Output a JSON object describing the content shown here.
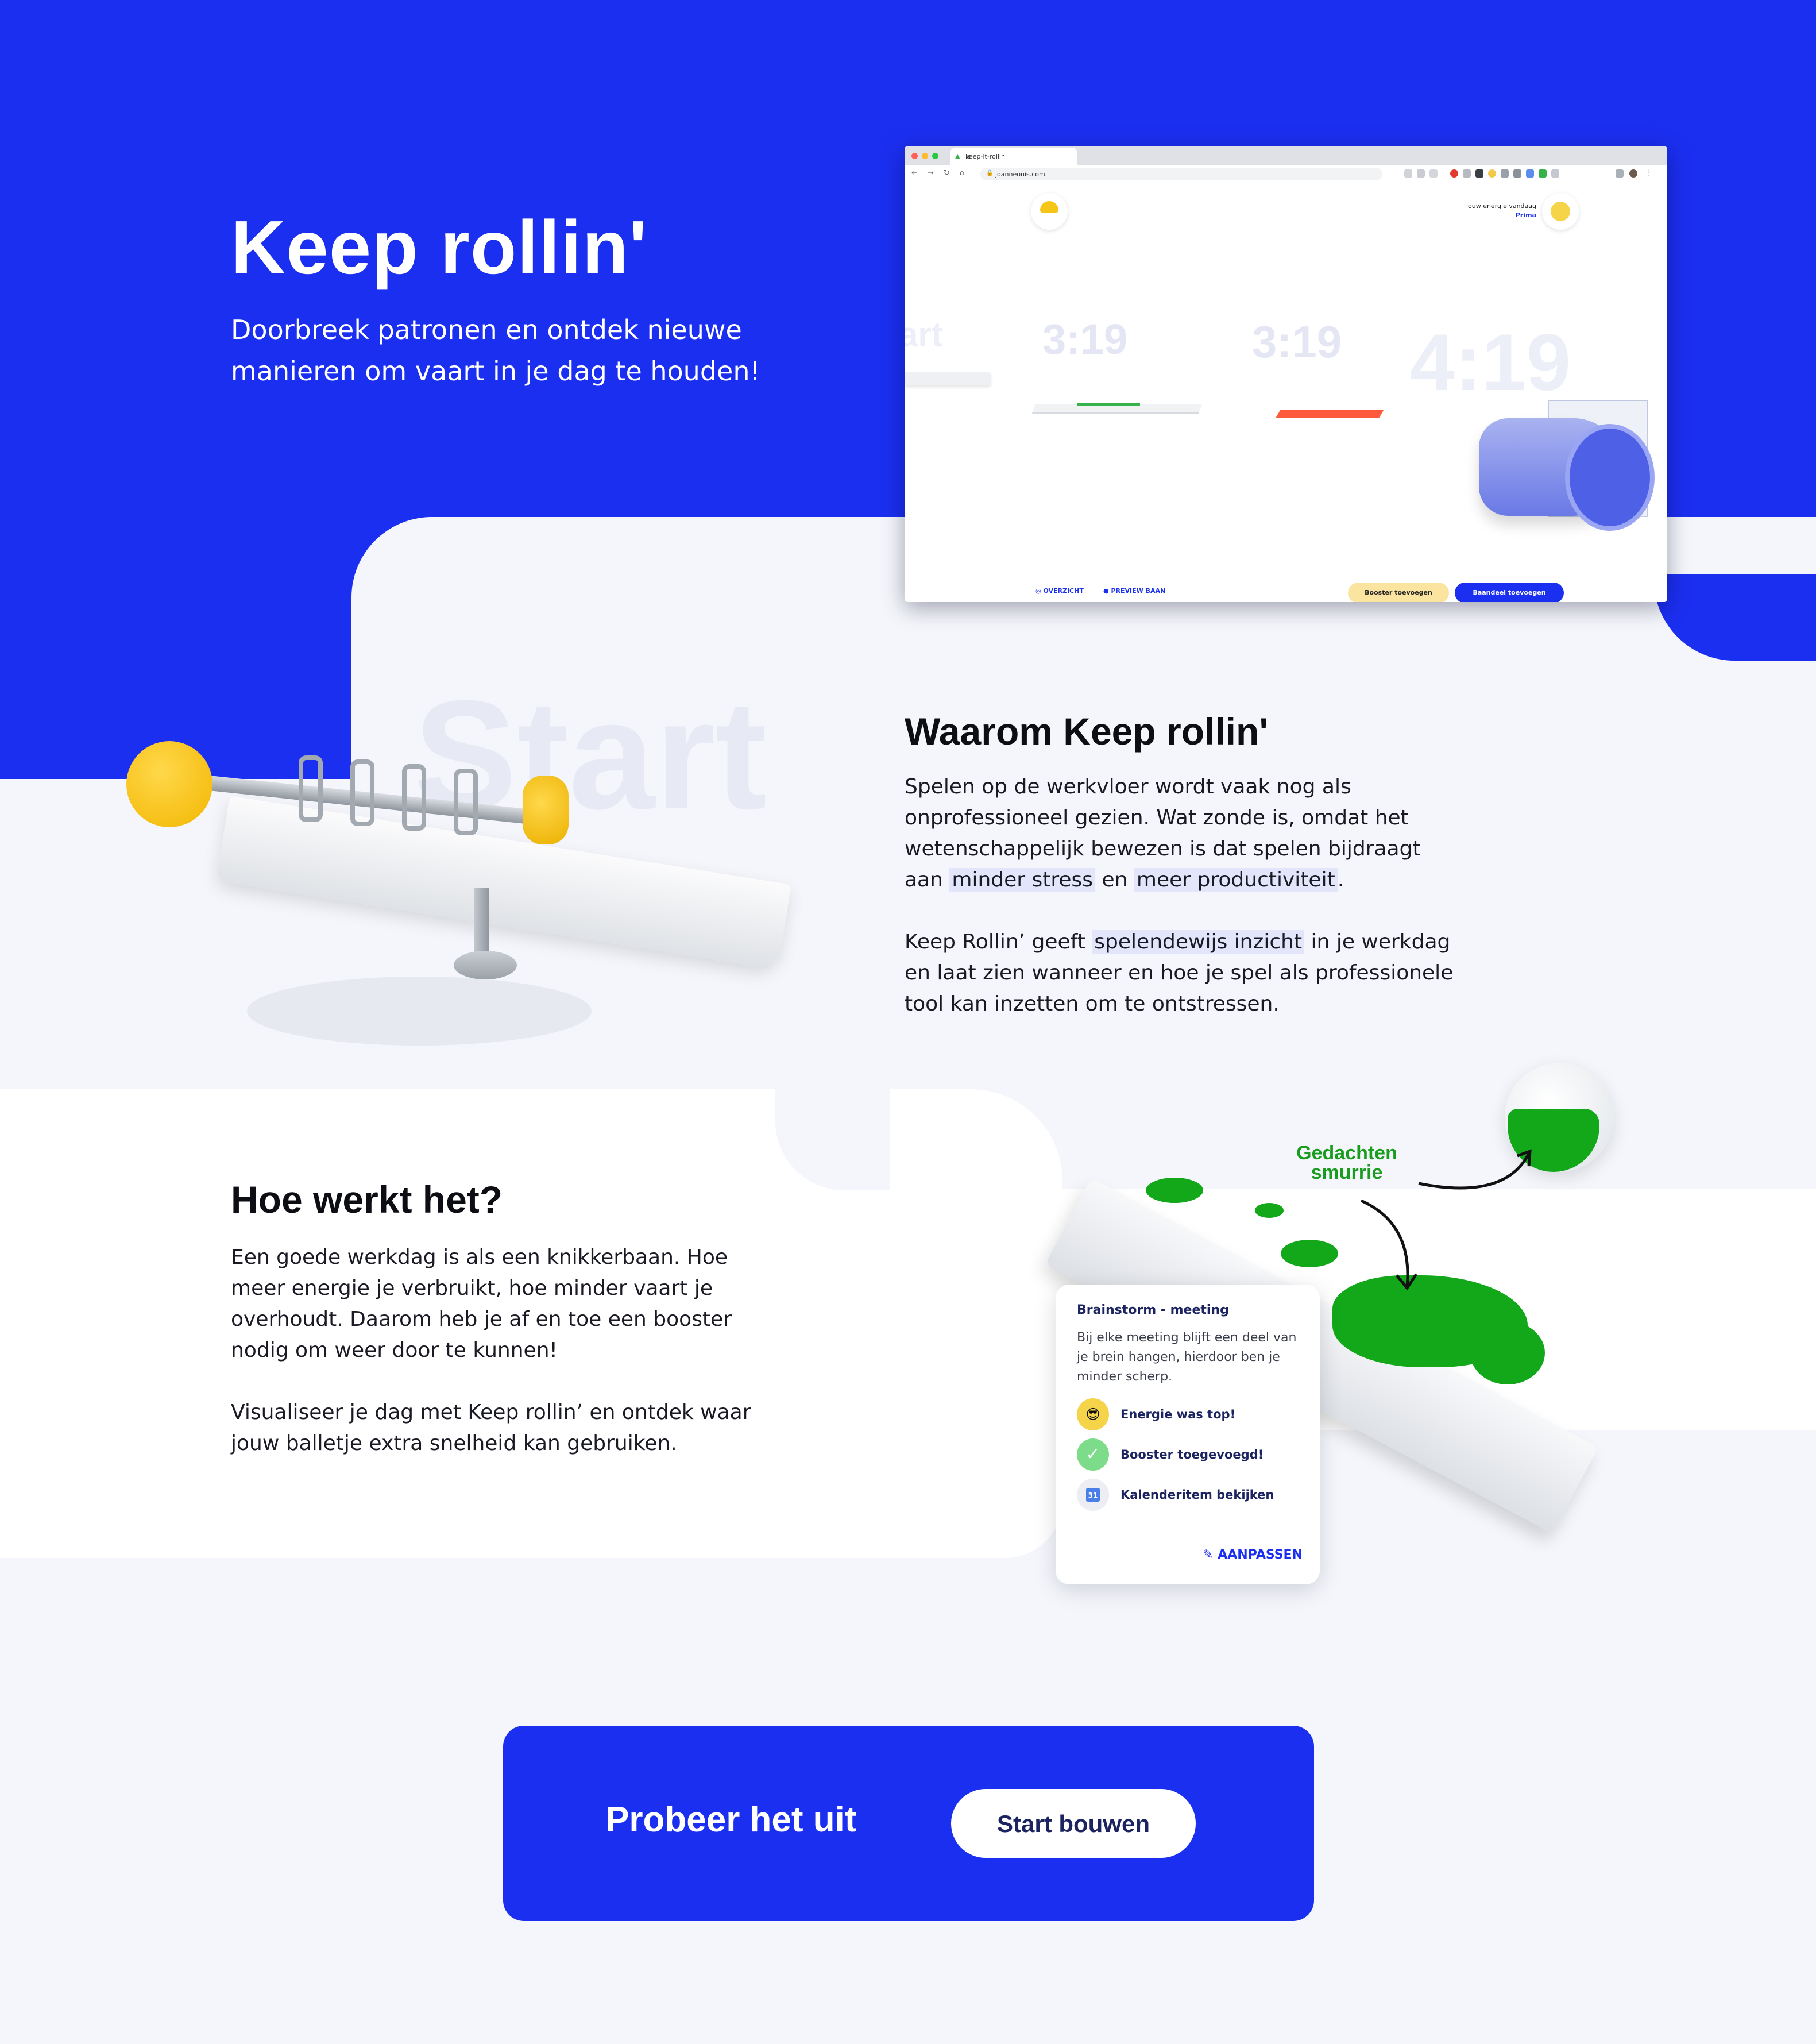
{
  "hero": {
    "title": "Keep rollin'",
    "subtitle": "Doorbreek patronen en ontdek nieuwe manieren om vaart in je dag te houden!"
  },
  "browser": {
    "tab_title": "keep-it-rollin",
    "url": "joanneonis.com",
    "energy_label": "jouw energie vandaag",
    "energy_value": "Prima",
    "timers": [
      "art",
      "3:19",
      "3:19",
      "4:19"
    ],
    "links": {
      "overview": "OVERZICHT",
      "preview": "PREVIEW BAAN"
    },
    "buttons": {
      "booster": "Booster toevoegen",
      "part": "Baandeel toevoegen"
    }
  },
  "watermark": "Start",
  "why": {
    "title": "Waarom Keep rollin'",
    "p1_a": "Spelen op de werkvloer wordt vaak nog als onprofessioneel gezien. Wat zonde is, omdat het wetenschappelijk bewezen is dat spelen bijdraagt aan ",
    "p1_hl1": "minder stress",
    "p1_b": " en ",
    "p1_hl2": "meer productiviteit",
    "p1_c": ".",
    "p2_a": "Keep Rollin’ geeft ",
    "p2_hl": "spelendewijs inzicht",
    "p2_b": " in je werkdag en laat zien wanneer en hoe je spel als professionele tool kan inzetten om te ontstressen."
  },
  "how": {
    "title": "Hoe werkt het?",
    "p1": "Een goede werkdag is als een knikkerbaan. Hoe meer energie je verbruikt, hoe minder vaart je overhoudt. Daarom heb je af en toe een booster nodig om weer door te kunnen!",
    "p2": "Visualiseer je dag met Keep rollin’ en ontdek waar jouw balletje extra snelheid kan gebruiken."
  },
  "goo_label": "Gedachten smurrie",
  "card": {
    "title": "Brainstorm - meeting",
    "description": "Bij elke meeting blijft een deel van je brein hangen, hierdoor ben  je minder scherp.",
    "rows": [
      {
        "label": "Energie was top!",
        "icon": "sunglasses-emoji-icon"
      },
      {
        "label": "Booster toegevoegd!",
        "icon": "check-icon"
      },
      {
        "label": "Kalenderitem bekijken",
        "icon": "calendar-icon"
      }
    ],
    "edit_label": "AANPASSEN"
  },
  "cta": {
    "title": "Probeer het uit",
    "button": "Start bouwen"
  },
  "colors": {
    "brand_blue": "#1b2ff0",
    "light_bg": "#f4f6fb",
    "highlight": "#e3e6fb",
    "goo_green": "#12a81a",
    "accent_yellow": "#f5c518"
  }
}
